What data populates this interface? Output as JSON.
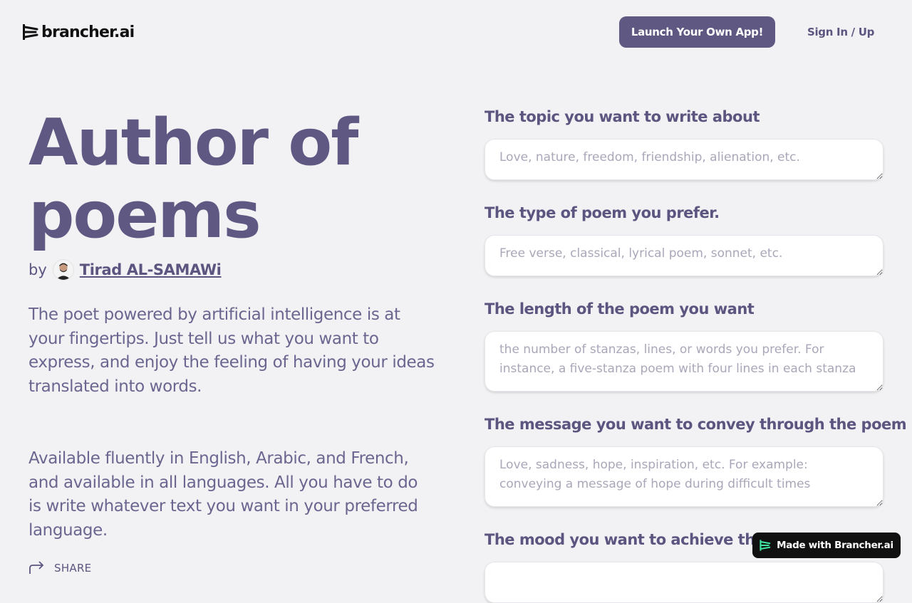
{
  "header": {
    "logo_text": "brancher.ai",
    "launch_label": "Launch Your Own App!",
    "signin_label": "Sign In / Up"
  },
  "hero": {
    "title": "Author of poems",
    "by": "by",
    "author": "Tirad AL-SAMAWi",
    "description_1": "The poet powered by artificial intelligence is at your fingertips. Just tell us what you want to express, and enjoy the feeling of having your ideas translated into words.",
    "description_2": "Available fluently in English, Arabic, and French, and available in all languages. All you have to do is write whatever text you want in your preferred language.",
    "share_label": "SHARE"
  },
  "form": {
    "fields": [
      {
        "label": "The topic you want to write about",
        "placeholder": "Love, nature, freedom, friendship, alienation, etc.",
        "value": ""
      },
      {
        "label": "The type of poem you prefer.",
        "placeholder": "Free verse, classical, lyrical poem, sonnet, etc.",
        "value": ""
      },
      {
        "label": "The length of the poem you want",
        "placeholder": "the number of stanzas, lines, or words you prefer. For instance, a five-stanza poem with four lines in each stanza",
        "value": ""
      },
      {
        "label": "The message you want to convey through the poem",
        "placeholder": "Love, sadness, hope, inspiration, etc. For example: conveying a message of hope during difficult times",
        "value": ""
      },
      {
        "label": "The mood you want to achieve throu",
        "placeholder": "",
        "value": ""
      }
    ]
  },
  "badge": {
    "label": "Made with Brancher.ai"
  },
  "colors": {
    "accent": "#5f5882",
    "background": "#f2f2f4",
    "badge_bg": "#111111",
    "badge_mark": "#3ee6a0"
  }
}
